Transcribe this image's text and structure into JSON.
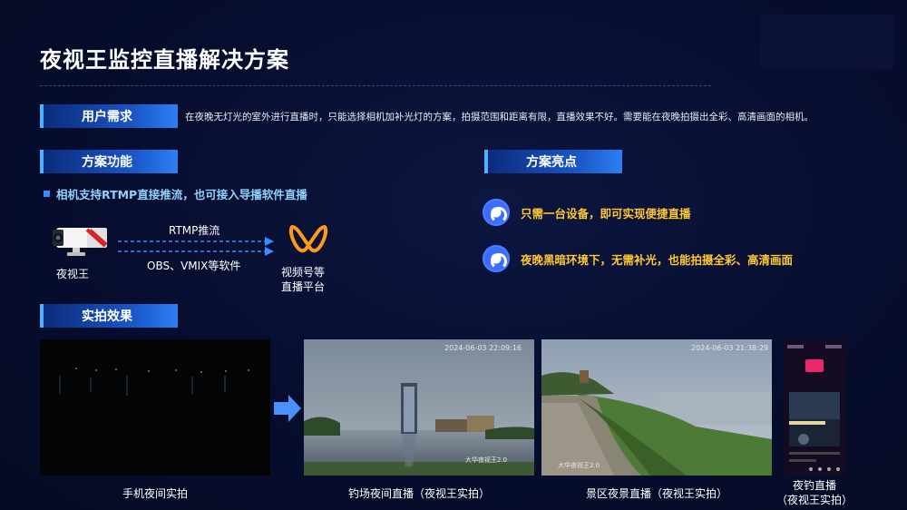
{
  "page": {
    "title": "夜视王监控直播解决方案"
  },
  "sections": {
    "needs": {
      "tag": "用户需求",
      "text": "在夜晚无灯光的室外进行直播时，只能选择相机加补光灯的方案，拍摄范围和距离有限，直播效果不好。需要能在夜晚拍摄出全彩、高清画面的相机。"
    },
    "functions": {
      "tag": "方案功能",
      "bullet": "相机支持RTMP直接推流，也可接入导播软件直播",
      "camera_label": "夜视王",
      "rtmp_label": "RTMP推流",
      "software_label": "OBS、VMIX等软件",
      "platform_label_line1": "视频号等",
      "platform_label_line2": "直播平台"
    },
    "highlights": {
      "tag": "方案亮点",
      "items": [
        {
          "text": "只需一台设备，即可实现便捷直播"
        },
        {
          "text": "夜晚黑暗环境下，无需补光，也能拍摄全彩、高清画面"
        }
      ]
    },
    "results": {
      "tag": "实拍效果",
      "photos": [
        {
          "label": "手机夜间实拍"
        },
        {
          "label": "钓场夜间直播（夜视王实拍）",
          "timestamp": "2024-06-03 22:09:16",
          "watermark": "大华夜视王2.0"
        },
        {
          "label": "景区夜景直播（夜视王实拍）",
          "timestamp": "2024-06-03 21:38:29",
          "watermark": "大华夜视王2.0"
        },
        {
          "label_line1": "夜钓直播",
          "label_line2": "（夜视王实拍）"
        }
      ]
    }
  },
  "colors": {
    "background": "#070d2e",
    "tag_gradient_end": "#2a7df0",
    "highlight_text": "#ffc832",
    "bullet_text": "#8fd2ff",
    "arrow": "#3a8cff",
    "logo_orange": "#ff9a1a"
  },
  "icons": {
    "highlight": "circular-badge-icon",
    "logo": "wechat-channels-logo",
    "arrow": "right-arrow-icon"
  }
}
